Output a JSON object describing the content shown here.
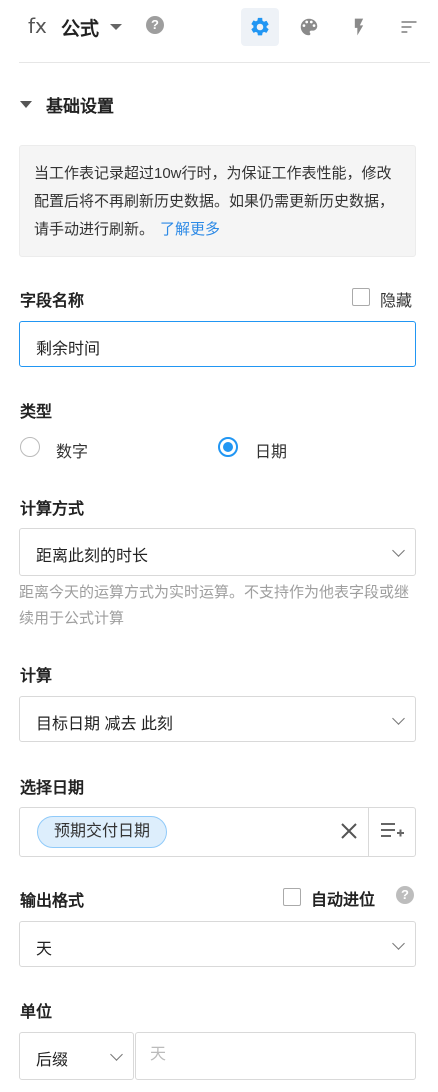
{
  "header": {
    "fx_label": "fx",
    "title": "公式",
    "help_glyph": "?",
    "toolbar_icons": [
      "gear-icon",
      "palette-icon",
      "bolt-icon",
      "sort-icon"
    ],
    "active_icon": "gear-icon",
    "accent_color": "#2196f3"
  },
  "section": {
    "title": "基础设置"
  },
  "notice": {
    "text": "当工作表记录超过10w行时，为保证工作表性能，修改配置后将不再刷新历史数据。如果仍需更新历史数据，请手动进行刷新。",
    "link": "了解更多"
  },
  "field_name": {
    "label": "字段名称",
    "hide_label": "隐藏",
    "value": "剩余时间"
  },
  "type": {
    "label": "类型",
    "options": [
      "数字",
      "日期"
    ],
    "selected": "日期"
  },
  "calc_method": {
    "label": "计算方式",
    "value": "距离此刻的时长",
    "hint": "距离今天的运算方式为实时运算。不支持作为他表字段或继续用于公式计算"
  },
  "calc": {
    "label": "计算",
    "value": "目标日期 减去 此刻"
  },
  "select_date": {
    "label": "选择日期",
    "tag": "预期交付日期"
  },
  "output_format": {
    "label": "输出格式",
    "auto_carry": "自动进位",
    "help_glyph": "?",
    "value": "天"
  },
  "unit": {
    "label": "单位",
    "position": "后缀",
    "placeholder": "天"
  }
}
